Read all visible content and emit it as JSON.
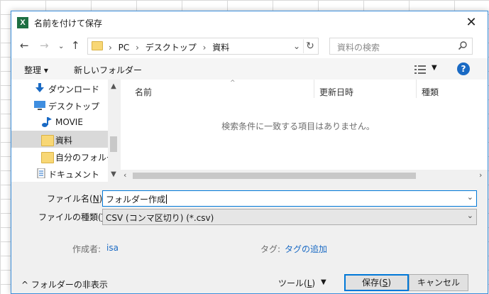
{
  "window": {
    "title": "名前を付けて保存",
    "app_icon_letter": "X"
  },
  "nav": {
    "breadcrumbs": [
      "PC",
      "デスクトップ",
      "資料"
    ],
    "search_placeholder": "資料の検索"
  },
  "toolbar": {
    "organize": "整理 ▾",
    "new_folder": "新しいフォルダー",
    "help": "?"
  },
  "sidebar": {
    "items": [
      {
        "label": "ダウンロード",
        "icon": "download-arrow-icon"
      },
      {
        "label": "デスクトップ",
        "icon": "desktop-icon"
      },
      {
        "label": "MOVIE",
        "icon": "music-note-icon"
      },
      {
        "label": "資料",
        "icon": "folder-icon",
        "selected": true
      },
      {
        "label": "自分のフォルダ-",
        "icon": "folder-shortcut-icon"
      },
      {
        "label": "ドキュメント",
        "icon": "document-icon"
      }
    ]
  },
  "filelist": {
    "columns": [
      "名前",
      "更新日時",
      "種類"
    ],
    "empty_message": "検索条件に一致する項目はありません。"
  },
  "form": {
    "filename_label_prefix": "ファイル名(",
    "filename_label_key": "N",
    "filename_label_suffix": "):",
    "filename_value": "フォルダー作成",
    "filetype_label_prefix": "ファイルの種類(",
    "filetype_label_key": "T",
    "filetype_label_suffix": "):",
    "filetype_value": "CSV (コンマ区切り) (*.csv)",
    "author_label": "作成者:",
    "author_value": "isa",
    "tags_label": "タグ:",
    "tags_value": "タグの追加"
  },
  "footer": {
    "hide_folders": "フォルダーの非表示",
    "tools_prefix": "ツール(",
    "tools_key": "L",
    "tools_suffix": ")",
    "save_prefix": "保存(",
    "save_key": "S",
    "save_suffix": ")",
    "cancel": "キャンセル"
  }
}
